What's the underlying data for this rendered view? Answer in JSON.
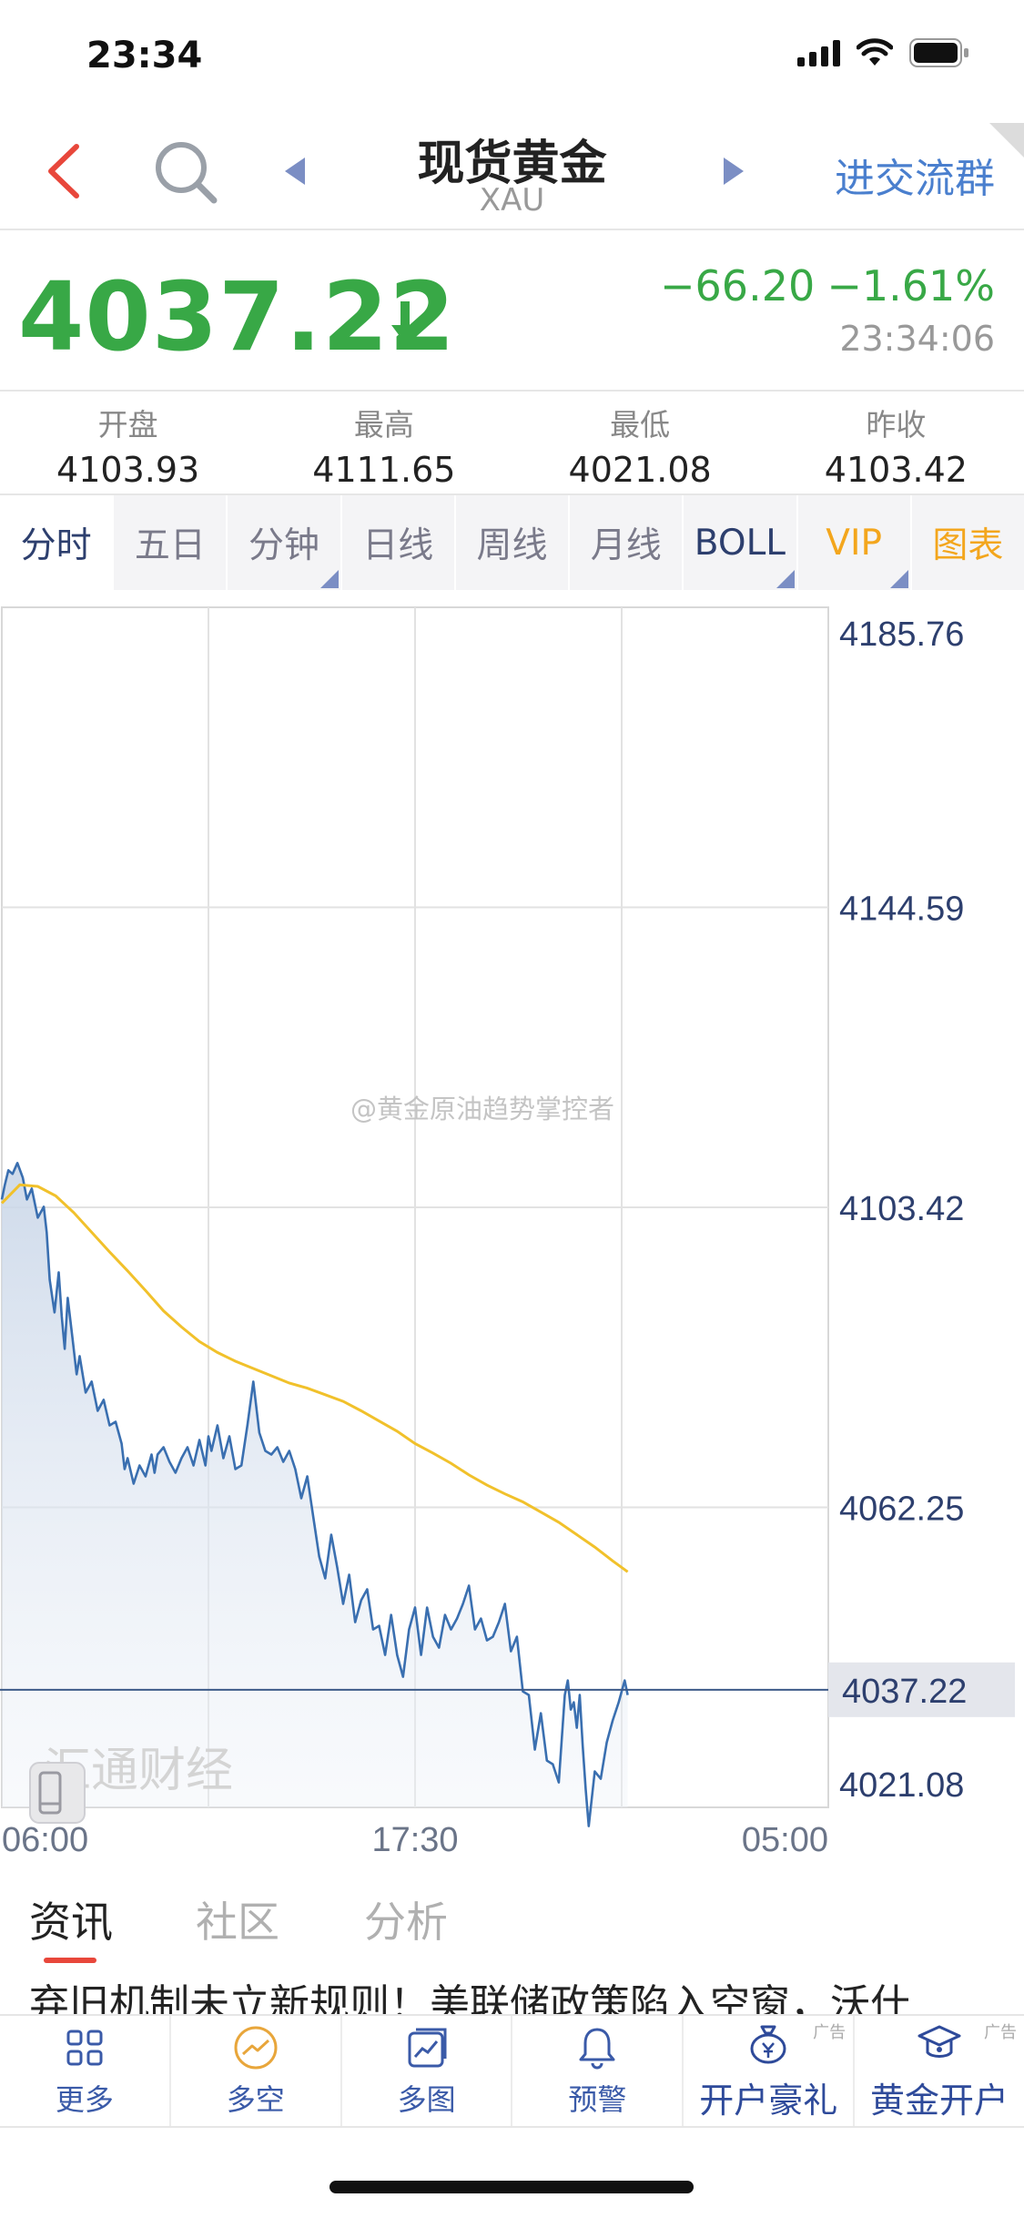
{
  "status": {
    "time": "23:34"
  },
  "nav": {
    "title": "现货黄金",
    "subtitle": "XAU",
    "group_link": "进交流群"
  },
  "quote": {
    "price": "4037.22",
    "change": "−66.20",
    "pct": "−1.61%",
    "time": "23:34:06"
  },
  "stats": [
    {
      "label": "开盘",
      "value": "4103.93"
    },
    {
      "label": "最高",
      "value": "4111.65"
    },
    {
      "label": "最低",
      "value": "4021.08"
    },
    {
      "label": "昨收",
      "value": "4103.42"
    }
  ],
  "tabs": [
    {
      "label": "分时",
      "active": true
    },
    {
      "label": "五日"
    },
    {
      "label": "分钟",
      "corner": true
    },
    {
      "label": "日线"
    },
    {
      "label": "周线"
    },
    {
      "label": "月线"
    },
    {
      "label": "BOLL",
      "corner": true
    },
    {
      "label": "VIP",
      "corner": true
    },
    {
      "label": "图表"
    }
  ],
  "chart_data": {
    "type": "area",
    "x_tick_labels": [
      "06:00",
      "17:30",
      "05:00"
    ],
    "y_tick_labels": [
      "4185.76",
      "4144.59",
      "4103.42",
      "4062.25",
      "4021.08"
    ],
    "ylim": [
      4021.08,
      4185.76
    ],
    "reference_value": 4037.22,
    "reference_label": "4037.22",
    "x_total_minutes": 1380,
    "series": [
      {
        "kind": "price",
        "color": "#3a6fb0",
        "x": [
          0,
          5,
          11,
          18,
          26,
          35,
          42,
          50,
          60,
          70,
          75,
          80,
          88,
          95,
          100,
          105,
          110,
          118,
          125,
          130,
          140,
          150,
          160,
          170,
          180,
          190,
          200,
          205,
          210,
          220,
          230,
          240,
          250,
          255,
          260,
          270,
          280,
          290,
          300,
          310,
          320,
          330,
          340,
          345,
          350,
          360,
          370,
          380,
          390,
          400,
          410,
          420,
          430,
          440,
          450,
          460,
          470,
          480,
          490,
          500,
          510,
          520,
          530,
          540,
          550,
          560,
          570,
          580,
          590,
          600,
          610,
          620,
          630,
          640,
          650,
          660,
          670,
          680,
          690,
          700,
          710,
          720,
          730,
          740,
          750,
          760,
          770,
          780,
          790,
          800,
          810,
          820,
          830,
          840,
          850,
          860,
          870,
          880,
          890,
          900,
          910,
          920,
          930,
          940,
          945,
          950,
          955,
          960,
          965,
          970,
          975,
          980,
          990,
          1000,
          1010,
          1020,
          1030,
          1040,
          1045
        ],
        "values": [
          4104.5,
          4106.5,
          4108.5,
          4108.0,
          4109.5,
          4107.5,
          4104.5,
          4106.0,
          4102.0,
          4103.5,
          4100.0,
          4093.5,
          4089.0,
          4094.5,
          4088.5,
          4084.0,
          4091.0,
          4085.5,
          4080.5,
          4083.0,
          4078.0,
          4079.5,
          4075.5,
          4077.0,
          4073.5,
          4074.0,
          4071.0,
          4067.5,
          4069.0,
          4065.5,
          4068.0,
          4066.5,
          4069.5,
          4067.0,
          4069.5,
          4070.5,
          4068.5,
          4067.0,
          4069.0,
          4070.5,
          4068.0,
          4071.5,
          4068.0,
          4072.0,
          4070.0,
          4073.5,
          4069.0,
          4072.0,
          4067.5,
          4068.0,
          4073.5,
          4079.5,
          4072.5,
          4070.0,
          4069.5,
          4070.5,
          4068.5,
          4070.0,
          4067.5,
          4063.5,
          4066.5,
          4061.0,
          4055.5,
          4052.5,
          4058.5,
          4054.0,
          4049.0,
          4053.0,
          4046.5,
          4049.5,
          4051.0,
          4045.5,
          4046.0,
          4042.0,
          4047.5,
          4042.0,
          4039.0,
          4045.5,
          4048.5,
          4042.0,
          4048.5,
          4044.5,
          4043.0,
          4047.5,
          4045.5,
          4047.0,
          4049.0,
          4051.5,
          4045.5,
          4047.0,
          4044.0,
          4044.5,
          4046.5,
          4049.0,
          4042.5,
          4044.5,
          4037.0,
          4036.5,
          4029.0,
          4034.0,
          4027.5,
          4027.0,
          4024.5,
          4036.5,
          4038.5,
          4034.5,
          4035.5,
          4032.0,
          4036.5,
          4029.5,
          4023.5,
          4018.5,
          4026.0,
          4025.0,
          4030.0,
          4033.0,
          4035.5,
          4038.5,
          4036.5
        ]
      },
      {
        "kind": "average",
        "color": "#f1c12b",
        "x": [
          0,
          30,
          60,
          90,
          120,
          150,
          180,
          210,
          240,
          270,
          300,
          330,
          360,
          390,
          420,
          450,
          480,
          510,
          540,
          570,
          600,
          630,
          660,
          690,
          720,
          750,
          780,
          810,
          840,
          870,
          900,
          930,
          960,
          990,
          1020,
          1045
        ],
        "values": [
          4104.0,
          4106.5,
          4106.3,
          4105.0,
          4102.7,
          4100.0,
          4097.3,
          4094.7,
          4092.0,
          4089.2,
          4087.0,
          4085.0,
          4083.5,
          4082.3,
          4081.3,
          4080.3,
          4079.3,
          4078.6,
          4077.7,
          4076.8,
          4075.5,
          4074.1,
          4072.7,
          4071.0,
          4069.7,
          4068.3,
          4066.7,
          4065.3,
          4064.1,
          4063.0,
          4061.6,
          4060.2,
          4058.5,
          4056.8,
          4054.9,
          4053.4
        ]
      }
    ]
  },
  "watermarks": {
    "weibo": "@黄金原油趋势掌控者",
    "brand": "汇通财经"
  },
  "news": {
    "tabs": [
      "资讯",
      "社区",
      "分析"
    ],
    "headline": "弃旧机制未立新规则！美联储政策陷入空窗，沃什"
  },
  "bottom_bar": [
    {
      "label": "更多",
      "icon": "grid-icon"
    },
    {
      "label": "多空",
      "icon": "trend-circle-icon"
    },
    {
      "label": "多图",
      "icon": "chart-card-icon"
    },
    {
      "label": "预警",
      "icon": "bell-icon"
    },
    {
      "label": "开户豪礼",
      "icon": "money-bag-icon",
      "ad": "广告"
    },
    {
      "label": "黄金开户",
      "icon": "graduation-cap-icon",
      "ad": "广告"
    }
  ]
}
